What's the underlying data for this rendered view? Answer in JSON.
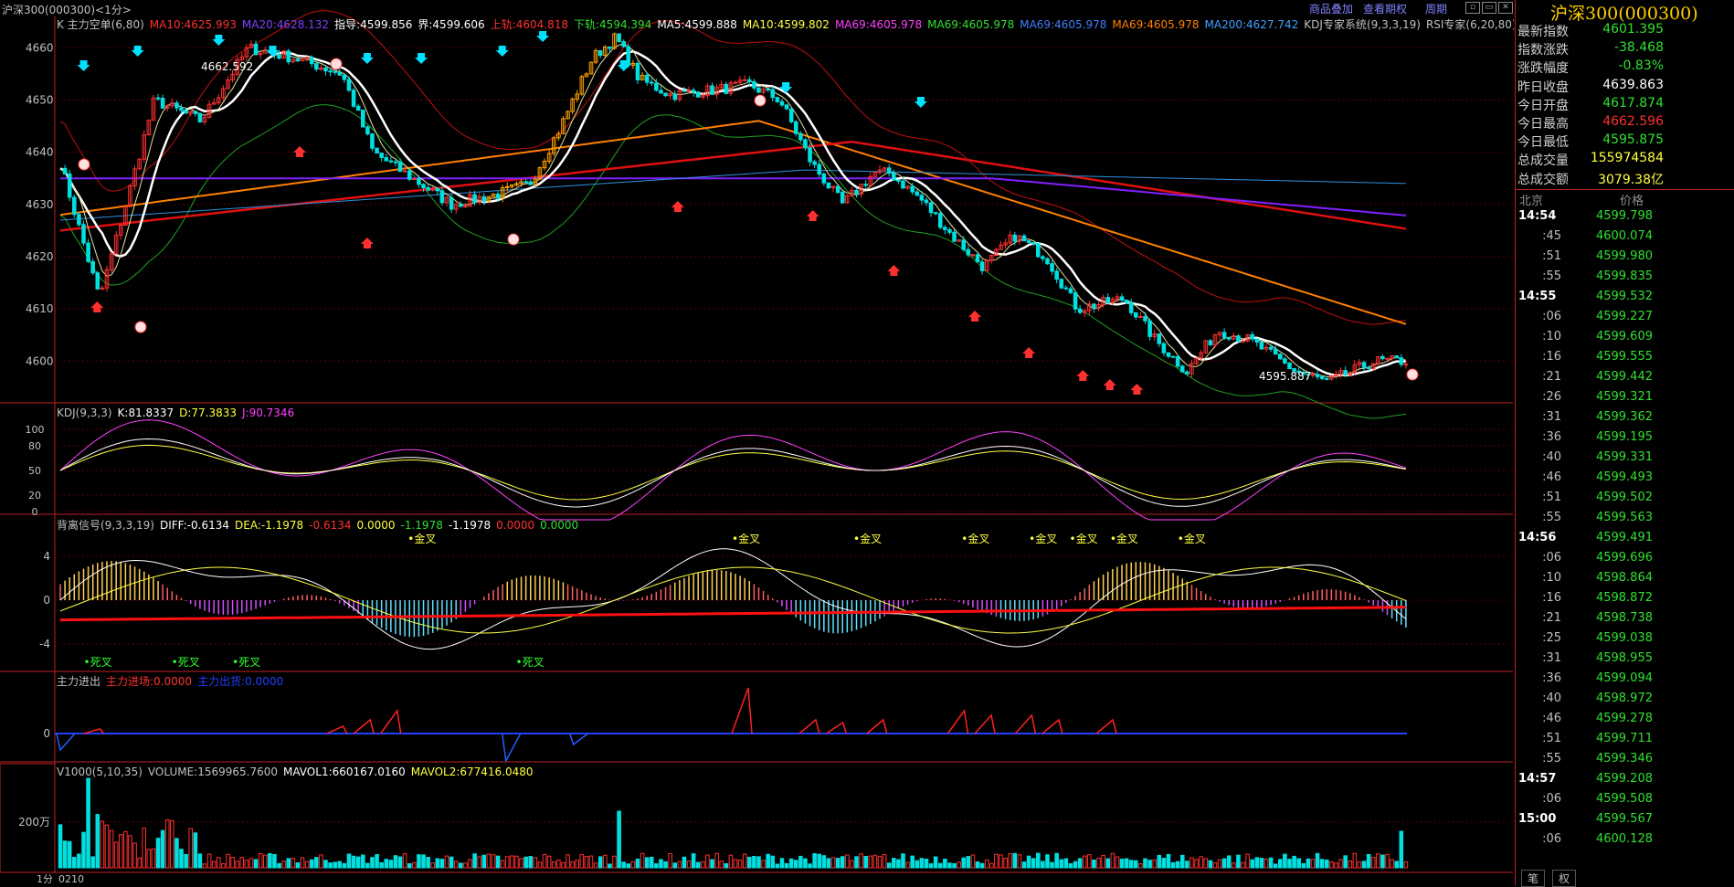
{
  "window": {
    "title": "沪深300(000300)<1分>"
  },
  "toolbar": {
    "btn_overlay": "商品叠加",
    "btn_options": "查看期权",
    "btn_period": "周期"
  },
  "main_panel": {
    "indicators": [
      {
        "text": "K  主力空单(6,80)",
        "color": "#c0c0c0"
      },
      {
        "text": "MA10:4625.993",
        "color": "#ff3030"
      },
      {
        "text": "MA20:4628.132",
        "color": "#8040ff"
      },
      {
        "text": "指导:4599.856",
        "color": "#ffffff"
      },
      {
        "text": "界:4599.606",
        "color": "#ffffff"
      },
      {
        "text": "上轨:4604.818",
        "color": "#ff3030"
      },
      {
        "text": "下轨:4594.394",
        "color": "#30e030"
      },
      {
        "text": "MA5:4599.888",
        "color": "#ffffff"
      },
      {
        "text": "MA10:4599.802",
        "color": "#ffff40"
      },
      {
        "text": "MA69:4605.978",
        "color": "#ff40ff"
      },
      {
        "text": "MA69:4605.978",
        "color": "#30e030"
      },
      {
        "text": "MA69:4605.978",
        "color": "#4080ff"
      },
      {
        "text": "MA69:4605.978",
        "color": "#ff8000"
      },
      {
        "text": "MA200:4627.742",
        "color": "#40a0ff"
      },
      {
        "text": "KDJ专家系统(9,3,3,19)",
        "color": "#c0c0c0"
      },
      {
        "text": "RSI专家(6,20,80)",
        "color": "#c0c0c0"
      }
    ],
    "y_labels": [
      "4660",
      "4650",
      "4640",
      "4630",
      "4620",
      "4610",
      "4600"
    ],
    "y_values": [
      4660,
      4650,
      4640,
      4630,
      4620,
      4610,
      4600
    ],
    "high_label": "4662.592",
    "low_label": "4595.887"
  },
  "kdj_panel": {
    "legend": [
      {
        "text": "KDJ(9,3,3)",
        "color": "#c0c0c0"
      },
      {
        "text": "K:81.8337",
        "color": "#ffffff"
      },
      {
        "text": "D:77.3833",
        "color": "#ffff40"
      },
      {
        "text": "J:90.7346",
        "color": "#ff40ff"
      }
    ],
    "y_labels": [
      "100",
      "80",
      "50",
      "20",
      "0"
    ]
  },
  "macd_panel": {
    "legend": [
      {
        "text": "背离信号(9,3,3,19)",
        "color": "#c0c0c0"
      },
      {
        "text": "DIFF:-0.6134",
        "color": "#ffffff"
      },
      {
        "text": "DEA:-1.1978",
        "color": "#ffff40"
      },
      {
        "text": "-0.6134",
        "color": "#ff3030"
      },
      {
        "text": "0.0000",
        "color": "#ffff40"
      },
      {
        "text": "-1.1978",
        "color": "#30e030"
      },
      {
        "text": "-1.1978",
        "color": "#ffffff"
      },
      {
        "text": "0.0000",
        "color": "#ff3030"
      },
      {
        "text": "0.0000",
        "color": "#30e030"
      }
    ],
    "y_labels": [
      "4",
      "0",
      "-4"
    ],
    "gold_label": "金叉",
    "dead_label": "死叉"
  },
  "flow_panel": {
    "legend": [
      {
        "text": "主力进出",
        "color": "#c0c0c0"
      },
      {
        "text": "主力进场:0.0000",
        "color": "#ff3030"
      },
      {
        "text": "主力出货:0.0000",
        "color": "#2040ff"
      }
    ],
    "y_labels": [
      "0"
    ]
  },
  "volume_panel": {
    "legend": [
      {
        "text": "V1000(5,10,35)",
        "color": "#c0c0c0"
      },
      {
        "text": "VOLUME:1569965.7600",
        "color": "#c0c0c0"
      },
      {
        "text": "MAVOL1:660167.0160",
        "color": "#ffffff"
      },
      {
        "text": "MAVOL2:677416.0480",
        "color": "#ffff40"
      }
    ],
    "y_labels": [
      "200万"
    ]
  },
  "x_axis": {
    "period": "1分",
    "start": "0210"
  },
  "quote": {
    "title": "沪深300(000300)",
    "rows": [
      {
        "label": "最新指数",
        "value": "4601.395",
        "color": "#30e030"
      },
      {
        "label": "指数涨跌",
        "value": "-38.468",
        "color": "#30e030"
      },
      {
        "label": "涨跌幅度",
        "value": "-0.83%",
        "color": "#30e030"
      },
      {
        "label": "昨日收盘",
        "value": "4639.863",
        "color": "#ffffff"
      },
      {
        "label": "今日开盘",
        "value": "4617.874",
        "color": "#30e030"
      },
      {
        "label": "今日最高",
        "value": "4662.596",
        "color": "#ff3030"
      },
      {
        "label": "今日最低",
        "value": "4595.875",
        "color": "#30e030"
      },
      {
        "label": "总成交量",
        "value": "155974584",
        "color": "#ffff40"
      },
      {
        "label": "总成交额",
        "value": "3079.38亿",
        "color": "#ffff40"
      }
    ]
  },
  "ticks": {
    "header_time": "北京",
    "header_price": "价格",
    "rows": [
      {
        "t": "14:54",
        "p": "4599.798",
        "major": true
      },
      {
        "t": ":45",
        "p": "4600.074"
      },
      {
        "t": ":51",
        "p": "4599.980"
      },
      {
        "t": ":55",
        "p": "4599.835"
      },
      {
        "t": "14:55",
        "p": "4599.532",
        "major": true
      },
      {
        "t": ":06",
        "p": "4599.227"
      },
      {
        "t": ":10",
        "p": "4599.609"
      },
      {
        "t": ":16",
        "p": "4599.555"
      },
      {
        "t": ":21",
        "p": "4599.442"
      },
      {
        "t": ":26",
        "p": "4599.321"
      },
      {
        "t": ":31",
        "p": "4599.362"
      },
      {
        "t": ":36",
        "p": "4599.195"
      },
      {
        "t": ":40",
        "p": "4599.331"
      },
      {
        "t": ":46",
        "p": "4599.493"
      },
      {
        "t": ":51",
        "p": "4599.502"
      },
      {
        "t": ":55",
        "p": "4599.563"
      },
      {
        "t": "14:56",
        "p": "4599.491",
        "major": true
      },
      {
        "t": ":06",
        "p": "4599.696"
      },
      {
        "t": ":10",
        "p": "4598.864"
      },
      {
        "t": ":16",
        "p": "4598.872"
      },
      {
        "t": ":21",
        "p": "4598.738"
      },
      {
        "t": ":25",
        "p": "4599.038"
      },
      {
        "t": ":31",
        "p": "4598.955"
      },
      {
        "t": ":36",
        "p": "4599.094"
      },
      {
        "t": ":40",
        "p": "4598.972"
      },
      {
        "t": ":46",
        "p": "4599.278"
      },
      {
        "t": ":51",
        "p": "4599.711"
      },
      {
        "t": ":55",
        "p": "4599.346"
      },
      {
        "t": "14:57",
        "p": "4599.208",
        "major": true
      },
      {
        "t": ":06",
        "p": "4599.508"
      },
      {
        "t": "15:00",
        "p": "4599.567",
        "major": true
      },
      {
        "t": ":06",
        "p": "4600.128"
      }
    ]
  },
  "tabs": {
    "tab1": "笔",
    "tab2": "权"
  }
}
